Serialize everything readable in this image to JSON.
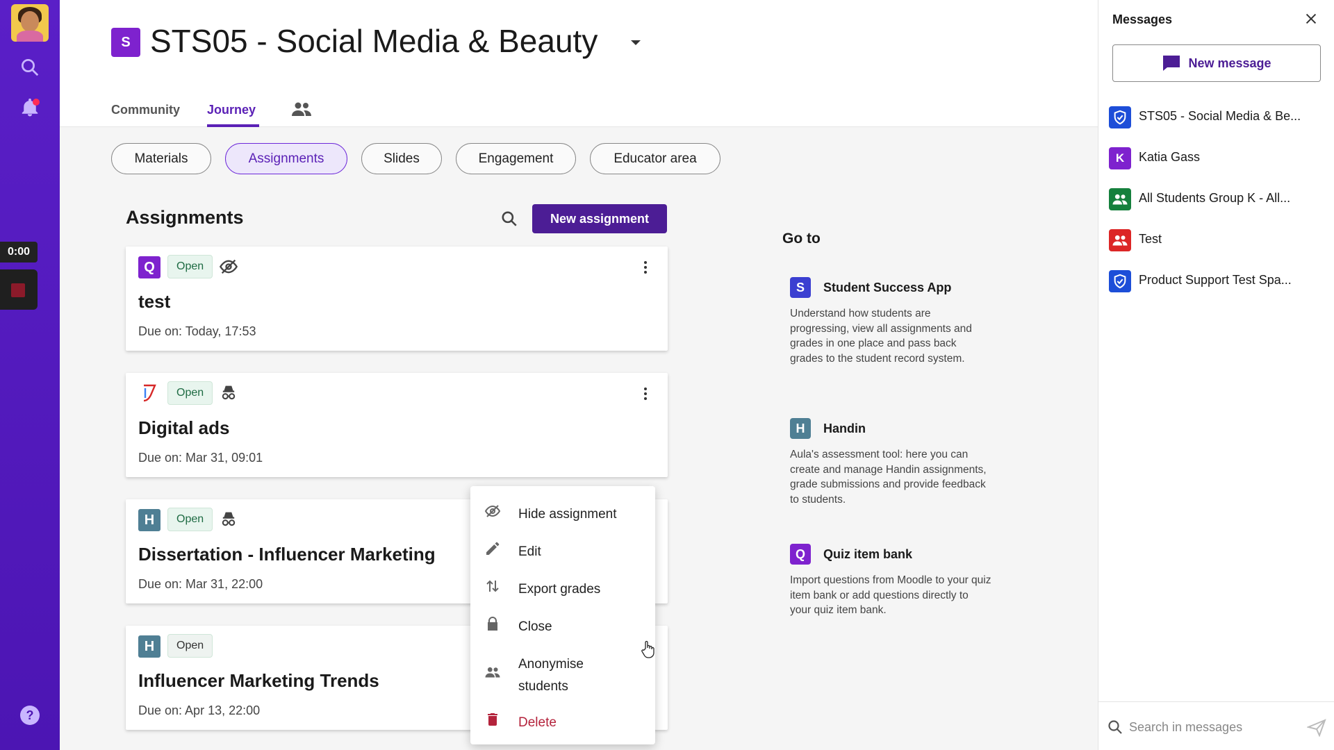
{
  "rail": {
    "timer": "0:00",
    "help_label": "?"
  },
  "course": {
    "badge": "S",
    "title": "STS05 - Social Media & Beauty",
    "badge_color": "#7e22ce"
  },
  "tabs": [
    {
      "label": "Community"
    },
    {
      "label": "Journey"
    }
  ],
  "pills": [
    {
      "label": "Materials"
    },
    {
      "label": "Assignments"
    },
    {
      "label": "Slides"
    },
    {
      "label": "Engagement"
    },
    {
      "label": "Educator area"
    }
  ],
  "assignments": {
    "heading": "Assignments",
    "new_button": "New assignment",
    "items": [
      {
        "badge": "Q",
        "status": "Open",
        "title": "test",
        "due": "Due on: Today, 17:53",
        "extra_icon": "eye-off-icon"
      },
      {
        "badge": "",
        "status": "Open",
        "title": "Digital ads",
        "due": "Due on: Mar 31, 09:01",
        "extra_icon": "anonymous-icon"
      },
      {
        "badge": "H",
        "status": "Open",
        "title": "Dissertation - Influencer Marketing",
        "due": "Due on: Mar 31, 22:00",
        "extra_icon": "anonymous-icon"
      },
      {
        "badge": "H",
        "status": "Open",
        "title": "Influencer Marketing Trends",
        "due": "Due on: Apr 13, 22:00",
        "extra_icon": ""
      }
    ]
  },
  "context_menu": {
    "items": [
      {
        "label": "Hide assignment",
        "icon": "eye-off-icon"
      },
      {
        "label": "Edit",
        "icon": "pencil-icon"
      },
      {
        "label": "Export grades",
        "icon": "swap-vertical-icon"
      },
      {
        "label": "Close",
        "icon": "lock-icon"
      },
      {
        "label": "Anonymise students",
        "icon": "people-icon"
      },
      {
        "label": "Delete",
        "icon": "trash-icon"
      }
    ]
  },
  "goto": {
    "title": "Go to",
    "apps": [
      {
        "badge": "S",
        "name": "Student Success App",
        "desc": "Understand how students are progressing, view all assignments and grades in one place and pass back grades to the student record system.",
        "color": "#3b3fd1"
      },
      {
        "badge": "H",
        "name": "Handin",
        "desc": "Aula's assessment tool: here you can create and manage Handin assignments, grade submissions and provide feedback to students.",
        "color": "#4f7f94"
      },
      {
        "badge": "Q",
        "name": "Quiz item bank",
        "desc": "Import questions from Moodle to your quiz item bank or add questions directly to your quiz item bank.",
        "color": "#7e22ce"
      }
    ]
  },
  "messages": {
    "title": "Messages",
    "new_message": "New message",
    "conversations": [
      {
        "name": "STS05 - Social Media & Be...",
        "badge": "",
        "color": "#1d4ed8",
        "icon": "shield-check-icon"
      },
      {
        "name": "Katia Gass",
        "badge": "K",
        "color": "#7e22ce",
        "icon": ""
      },
      {
        "name": "All Students Group K - All...",
        "badge": "",
        "color": "#15803d",
        "icon": "group-icon"
      },
      {
        "name": "Test",
        "badge": "",
        "color": "#dc2626",
        "icon": "group-icon"
      },
      {
        "name": "Product Support Test Spa...",
        "badge": "",
        "color": "#1d4ed8",
        "icon": "shield-check-icon"
      }
    ],
    "search_placeholder": "Search in messages"
  }
}
